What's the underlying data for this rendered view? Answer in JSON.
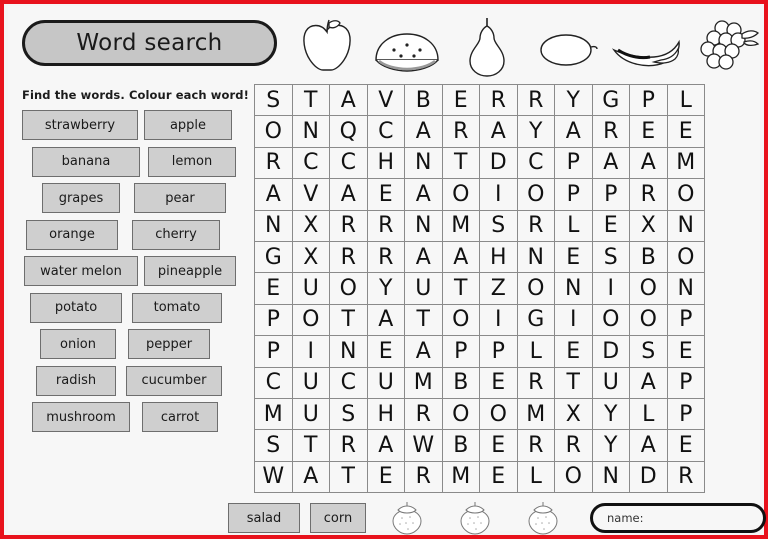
{
  "title": "Word search",
  "instruction": "Find the words. Colour each word!",
  "colors": {
    "page_border": "#e8121c",
    "chip_fill": "#cfcfcf",
    "chip_border": "#6e6e6e",
    "grid_line": "#8a8a8a",
    "page_background": "#f7f7f7"
  },
  "fruit_icons": [
    {
      "name": "apple-icon",
      "label": "apple"
    },
    {
      "name": "watermelon-icon",
      "label": "watermelon"
    },
    {
      "name": "pear-icon",
      "label": "pear"
    },
    {
      "name": "lemon-icon",
      "label": "lemon"
    },
    {
      "name": "banana-icon",
      "label": "banana"
    },
    {
      "name": "grapes-icon",
      "label": "grapes"
    }
  ],
  "word_list": [
    [
      "strawberry",
      "apple"
    ],
    [
      "banana",
      "lemon"
    ],
    [
      "grapes",
      "pear"
    ],
    [
      "orange",
      "cherry"
    ],
    [
      "water melon",
      "pineapple"
    ],
    [
      "potato",
      "tomato"
    ],
    [
      "onion",
      "pepper"
    ],
    [
      "radish",
      "cucumber"
    ],
    [
      "mushroom",
      "carrot"
    ]
  ],
  "bottom_words": [
    "salad",
    "corn"
  ],
  "strawberry_icons": [
    "strawberry-icon",
    "strawberry-icon",
    "strawberry-icon"
  ],
  "name_field": {
    "label": "name:",
    "value": ""
  },
  "grid": {
    "rows": 13,
    "cols": 12,
    "letters": [
      [
        "S",
        "T",
        "A",
        "V",
        "B",
        "E",
        "R",
        "R",
        "Y",
        "G",
        "P",
        "L"
      ],
      [
        "O",
        "N",
        "Q",
        "C",
        "A",
        "R",
        "A",
        "Y",
        "A",
        "R",
        "E",
        "E"
      ],
      [
        "R",
        "C",
        "C",
        "H",
        "N",
        "T",
        "D",
        "C",
        "P",
        "A",
        "A",
        "M"
      ],
      [
        "A",
        "V",
        "A",
        "E",
        "A",
        "O",
        "I",
        "O",
        "P",
        "P",
        "R",
        "O"
      ],
      [
        "N",
        "X",
        "R",
        "R",
        "N",
        "M",
        "S",
        "R",
        "L",
        "E",
        "X",
        "N"
      ],
      [
        "G",
        "X",
        "R",
        "R",
        "A",
        "A",
        "H",
        "N",
        "E",
        "S",
        "B",
        "O"
      ],
      [
        "E",
        "U",
        "O",
        "Y",
        "U",
        "T",
        "Z",
        "O",
        "N",
        "I",
        "O",
        "N"
      ],
      [
        "P",
        "O",
        "T",
        "A",
        "T",
        "O",
        "I",
        "G",
        "I",
        "O",
        "O",
        "P"
      ],
      [
        "P",
        "I",
        "N",
        "E",
        "A",
        "P",
        "P",
        "L",
        "E",
        "D",
        "S",
        "E"
      ],
      [
        "C",
        "U",
        "C",
        "U",
        "M",
        "B",
        "E",
        "R",
        "T",
        "U",
        "A",
        "P"
      ],
      [
        "M",
        "U",
        "S",
        "H",
        "R",
        "O",
        "O",
        "M",
        "X",
        "Y",
        "L",
        "P"
      ],
      [
        "S",
        "T",
        "R",
        "A",
        "W",
        "B",
        "E",
        "R",
        "R",
        "Y",
        "A",
        "E"
      ],
      [
        "W",
        "A",
        "T",
        "E",
        "R",
        "M",
        "E",
        "L",
        "O",
        "N",
        "D",
        "R"
      ]
    ]
  }
}
